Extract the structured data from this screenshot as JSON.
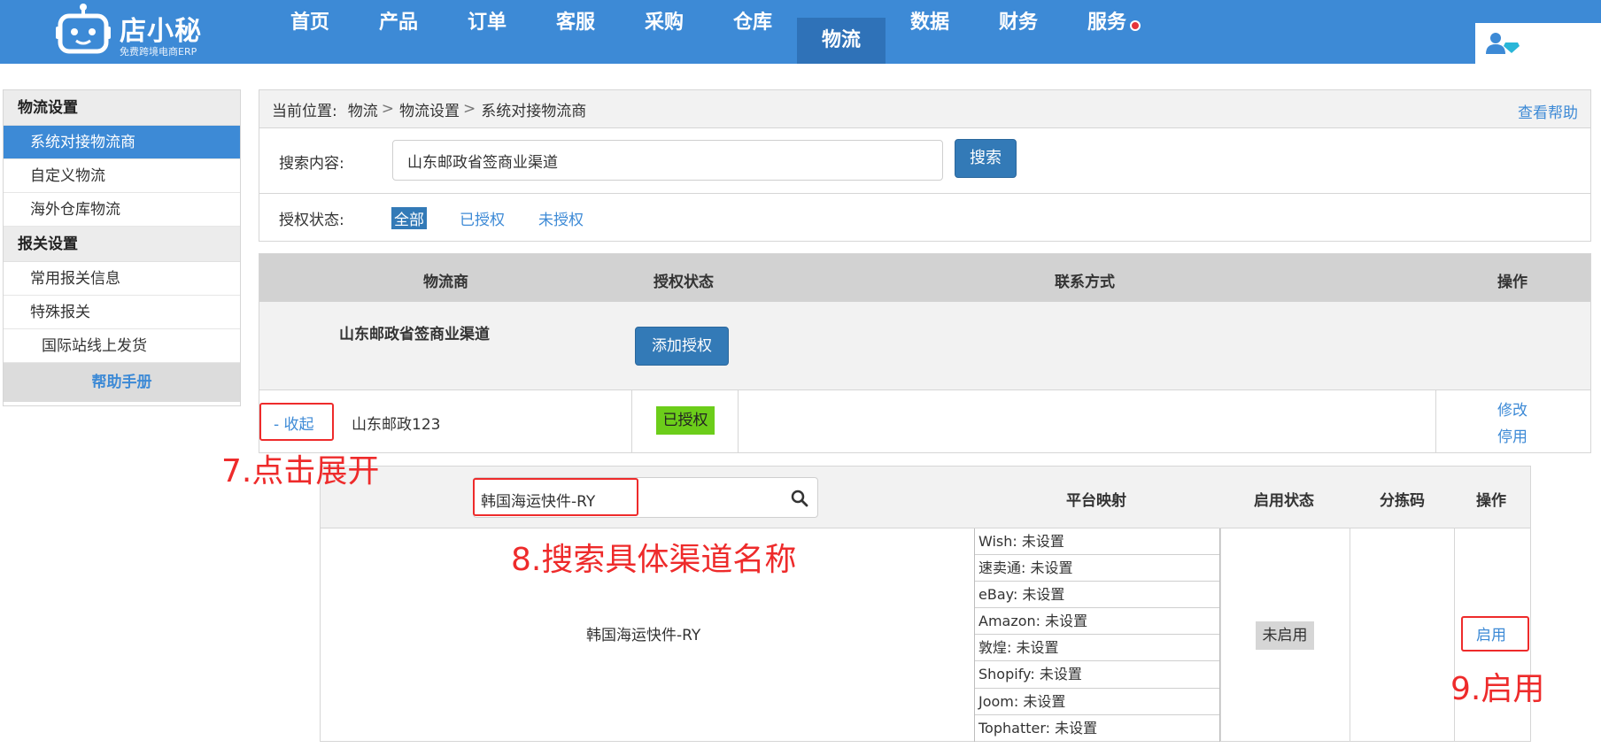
{
  "brand": {
    "name": "店小秘",
    "tagline": "免费跨境电商ERP",
    "color": "#3d8ad6"
  },
  "nav": {
    "items": [
      "首页",
      "产品",
      "订单",
      "客服",
      "采购",
      "仓库",
      "物流",
      "数据",
      "财务",
      "服务"
    ],
    "active": "物流"
  },
  "sidebar": {
    "section1": "物流设置",
    "items1": [
      "系统对接物流商",
      "自定义物流",
      "海外仓库物流"
    ],
    "section2": "报关设置",
    "items2": [
      "常用报关信息",
      "特殊报关",
      "国际站线上发货"
    ],
    "help": "帮助手册"
  },
  "breadcrumb": {
    "prefix": "当前位置:",
    "path": [
      "物流",
      "物流设置",
      "系统对接物流商"
    ],
    "help_link": "查看帮助"
  },
  "search": {
    "label": "搜索内容:",
    "value": "山东邮政省签商业渠道",
    "button": "搜索"
  },
  "auth_filter": {
    "label": "授权状态:",
    "options": [
      "全部",
      "已授权",
      "未授权"
    ],
    "selected": "全部"
  },
  "table": {
    "headers": [
      "物流商",
      "授权状态",
      "联系方式",
      "操作"
    ],
    "group_name": "山东邮政省签商业渠道",
    "add_auth": "添加授权",
    "row": {
      "toggle": "- 收起",
      "name": "山东邮政123",
      "status": "已授权",
      "actions": [
        "修改",
        "停用"
      ]
    }
  },
  "channels": {
    "search_value": "韩国海运快件-RY",
    "headers": [
      "平台映射",
      "启用状态",
      "分拣码",
      "操作"
    ],
    "row": {
      "name": "韩国海运快件-RY",
      "mappings": [
        {
          "platform": "Wish",
          "value": "未设置"
        },
        {
          "platform": "速卖通",
          "value": "未设置"
        },
        {
          "platform": "eBay",
          "value": "未设置"
        },
        {
          "platform": "Amazon",
          "value": "未设置"
        },
        {
          "platform": "敦煌",
          "value": "未设置"
        },
        {
          "platform": "Shopify",
          "value": "未设置"
        },
        {
          "platform": "Joom",
          "value": "未设置"
        },
        {
          "platform": "Tophatter",
          "value": "未设置"
        }
      ],
      "status": "未启用",
      "action": "启用"
    }
  },
  "annotations": {
    "step7": "7.点击展开",
    "step8": "8.搜索具体渠道名称",
    "step9": "9.启用"
  }
}
